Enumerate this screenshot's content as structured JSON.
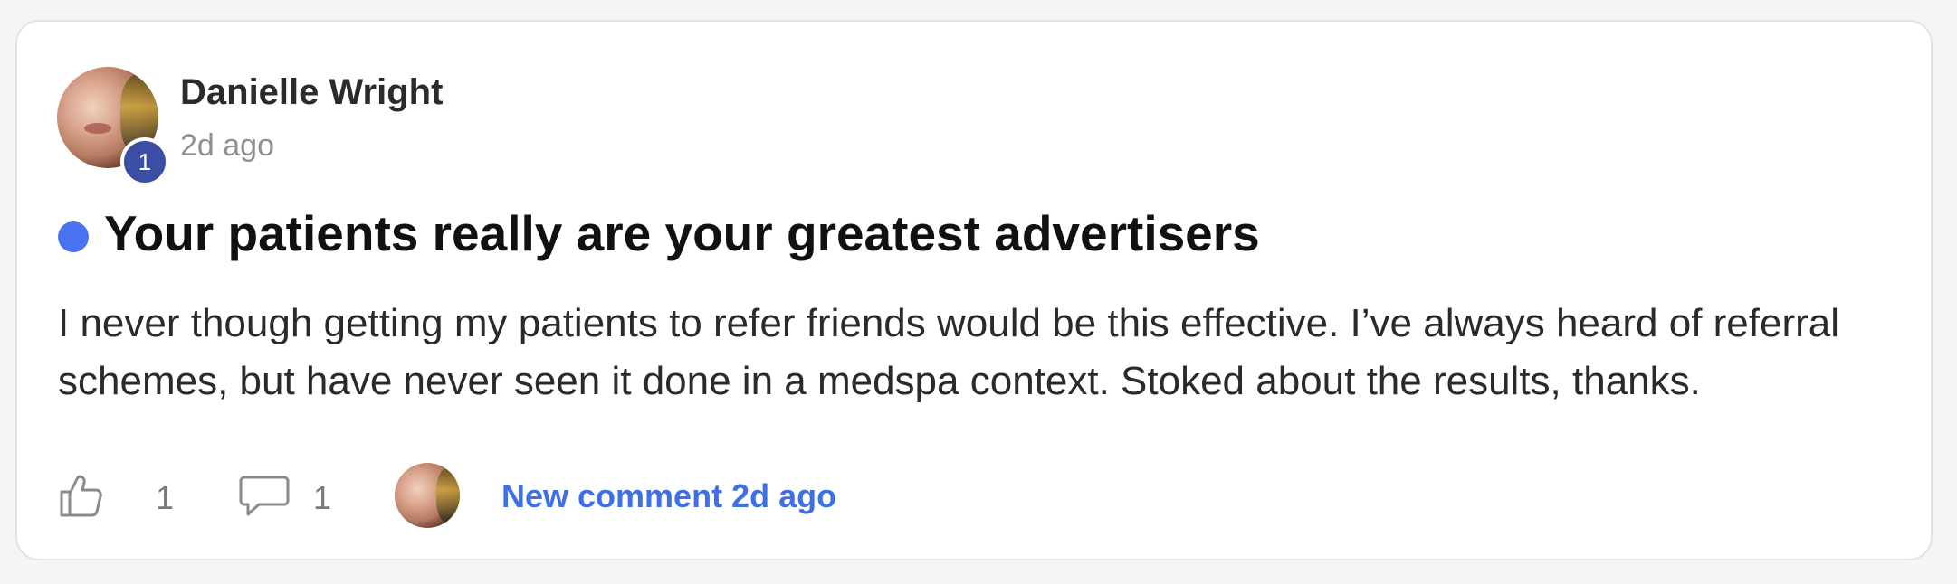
{
  "post": {
    "author": {
      "name": "Danielle Wright",
      "level": "1",
      "time_ago": "2d ago"
    },
    "unread": true,
    "title": "Your patients really are your greatest advertisers",
    "body": "I never though getting my patients to refer friends would be this effective. I’ve always heard of referral schemes, but have never seen it done in a medspa context. Stoked about the results, thanks.",
    "likes": "1",
    "comments": "1",
    "last_comment": {
      "label": "New comment 2d ago"
    }
  },
  "colors": {
    "accent": "#3d6fe6",
    "unread_dot": "#4a72f0",
    "level_badge": "#3b4ea3",
    "title_text": "#111111",
    "muted_text": "#8f8f8f"
  },
  "icons": {
    "like": "thumbs-up-icon",
    "comment": "speech-bubble-icon"
  }
}
